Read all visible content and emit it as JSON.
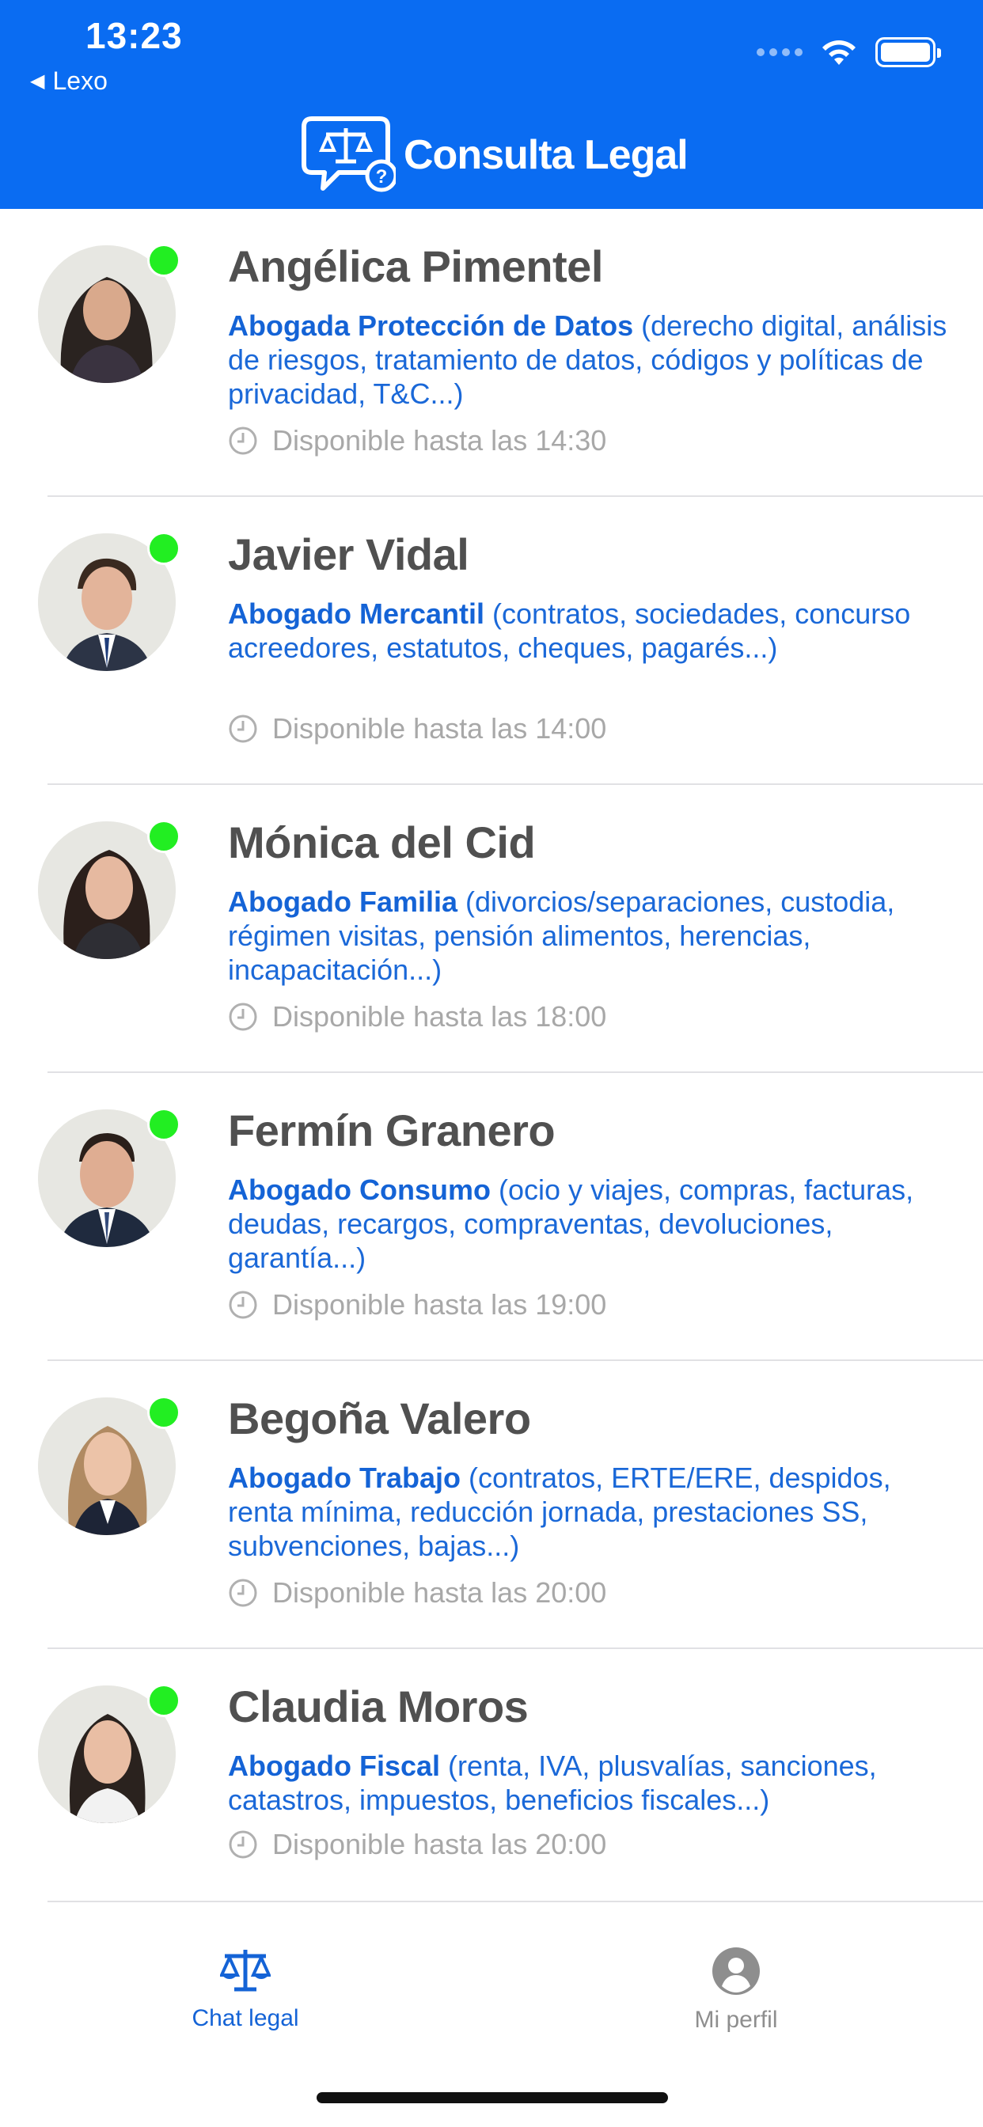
{
  "status_bar": {
    "time": "13:23",
    "back_app": "Lexo"
  },
  "header": {
    "title": "Consulta Legal"
  },
  "lawyers": [
    {
      "name": "Angélica Pimentel",
      "specialty_title": "Abogada Protección de Datos",
      "specialty_desc": " (derecho digital, análisis de riesgos, tratamiento de datos, códigos y políticas de privacidad, T&C...)",
      "availability": "Disponible hasta las 14:30",
      "online": true
    },
    {
      "name": "Javier Vidal",
      "specialty_title": "Abogado Mercantil",
      "specialty_desc": " (contratos, sociedades, concurso acreedores, estatutos, cheques, pagarés...)",
      "availability": "Disponible hasta las 14:00",
      "online": true
    },
    {
      "name": "Mónica del Cid",
      "specialty_title": "Abogado Familia",
      "specialty_desc": " (divorcios/separaciones, custodia, régimen visitas, pensión alimentos, herencias, incapacitación...)",
      "availability": "Disponible hasta las 18:00",
      "online": true
    },
    {
      "name": "Fermín Granero",
      "specialty_title": "Abogado Consumo",
      "specialty_desc": " (ocio y viajes, compras, facturas, deudas, recargos, compraventas, devoluciones, garantía...)",
      "availability": "Disponible hasta las 19:00",
      "online": true
    },
    {
      "name": "Begoña Valero",
      "specialty_title": "Abogado Trabajo",
      "specialty_desc": " (contratos, ERTE/ERE, despidos, renta mínima, reducción jornada, prestaciones SS, subvenciones, bajas...)",
      "availability": "Disponible hasta las 20:00",
      "online": true
    },
    {
      "name": "Claudia Moros",
      "specialty_title": "Abogado Fiscal",
      "specialty_desc": " (renta, IVA, plusvalías, sanciones, catastros, impuestos, beneficios fiscales...)",
      "availability": "Disponible hasta las 20:00",
      "online": true
    }
  ],
  "tabbar": {
    "chat_label": "Chat legal",
    "profile_label": "Mi perfil"
  },
  "colors": {
    "brand_blue": "#0a6cf2",
    "online_green": "#22ee22",
    "link_blue": "#1463d6"
  }
}
